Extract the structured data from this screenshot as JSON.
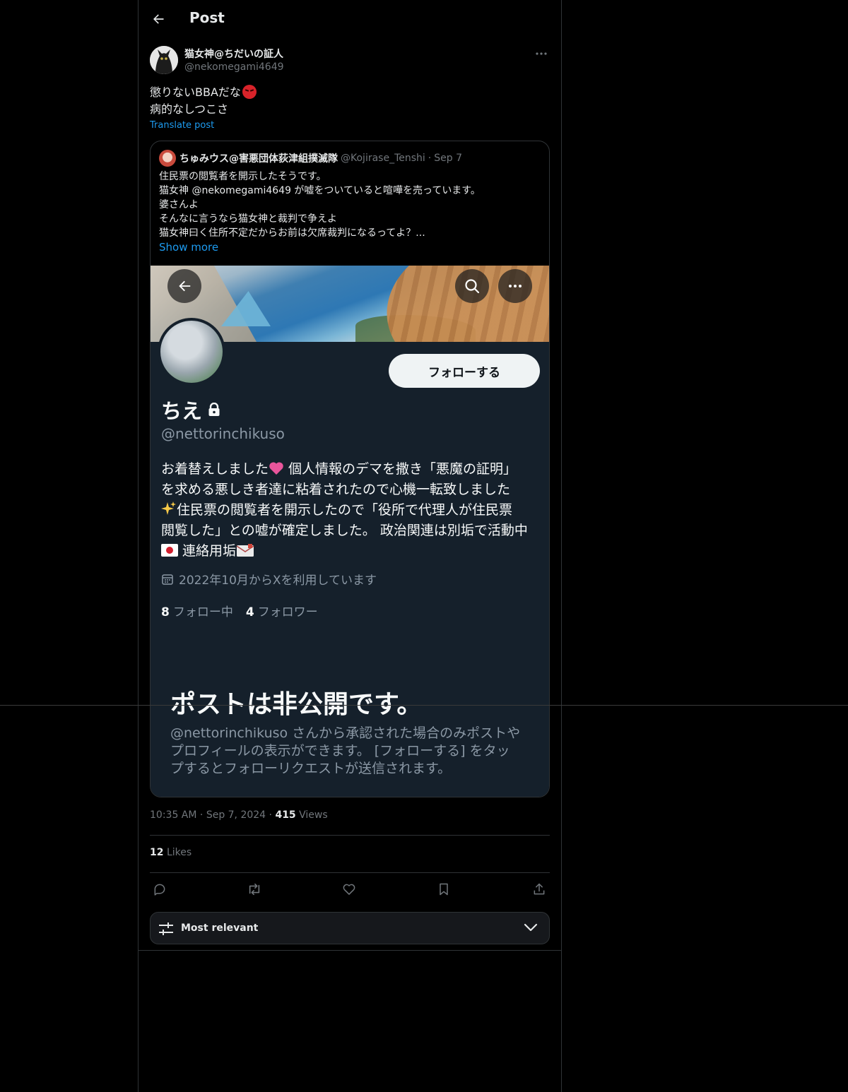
{
  "header": {
    "title": "Post",
    "back_icon": "arrow-left-icon"
  },
  "author": {
    "name": "猫女神@ちだいの証人",
    "handle": "@nekomegami4649",
    "more_icon": "more-horizontal-icon"
  },
  "post": {
    "lines": [
      "懲りないBBAだな",
      "病的なしつこさ"
    ],
    "translate_label": "Translate post"
  },
  "quote": {
    "name": "ちゅみウス@害悪団体荻津組撲滅隊",
    "handle": "@Kojirase_Tenshi",
    "separator": "·",
    "date": "Sep 7",
    "lines": [
      "住民票の閲覧者を開示したそうです。",
      "猫女神 @nekomegami4649 が嘘をついていると喧嘩を売っています。",
      "婆さんよ",
      "そんなに言うなら猫女神と裁判で争えよ",
      "猫女神曰く住所不定だからお前は欠席裁判になるってよ？..."
    ],
    "show_more": "Show more",
    "screenshot": {
      "follow_label": "フォローする",
      "display_name": "ちえ",
      "handle": "@nettorinchikuso",
      "bio_lines": [
        "お着替えしました",
        " 個人情報のデマを撒き「悪魔の証明」",
        "を求める悪しき者達に粘着されたので心機一転致しました",
        "住民票の閲覧者を開示したので「役所で代理人が住民票",
        "閲覧した」との嘘が確定しました。 政治関連は別垢で活動中",
        " 連絡用垢"
      ],
      "joined": "2022年10月からXを利用しています",
      "following_count": "8",
      "following_label": "フォロー中",
      "followers_count": "4",
      "followers_label": "フォロワー",
      "private_title": "ポストは非公開です。",
      "private_desc_lines": [
        "@nettorinchikuso さんから承認された場合のみポストや",
        "プロフィールの表示ができます。 [フォローする] をタッ",
        "プするとフォローリクエストが送信されます。"
      ]
    }
  },
  "meta": {
    "time": "10:35 AM",
    "dot": "·",
    "date": "Sep 7, 2024",
    "views_count": "415",
    "views_label": "Views"
  },
  "likes": {
    "count": "12",
    "label": "Likes"
  },
  "actions": [
    "reply-icon",
    "repost-icon",
    "like-icon",
    "bookmark-icon",
    "share-icon"
  ],
  "sort": {
    "label": "Most relevant",
    "icon": "sliders-icon",
    "chevron": "chevron-down-icon"
  },
  "colors": {
    "background": "#000000",
    "accent": "#1d9bf0",
    "secondary_text": "#71767b",
    "screenshot_bg": "#15202b"
  }
}
